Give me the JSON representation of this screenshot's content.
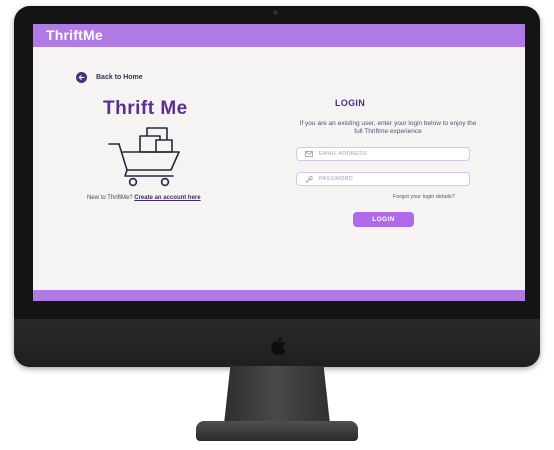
{
  "app": {
    "brand": "ThriftMe"
  },
  "colors": {
    "accent": "#b07ae4",
    "button": "#b069e8",
    "title": "#5b2e94",
    "screen_bg": "#f5f4f2",
    "monitor_bezel": "#141414"
  },
  "nav": {
    "back_label": "Back to Home",
    "back_icon": "arrow-left-icon"
  },
  "left_panel": {
    "title": "Thrift Me",
    "illustration_icon": "shopping-cart-icon",
    "signup_prompt": "New to ThriftMe?",
    "signup_link": "Create an account here"
  },
  "login": {
    "heading": "LOGIN",
    "description": "If you are an existing user, enter your login below to enjoy the full Thriftme experience",
    "email": {
      "placeholder": "EMAIL ADDRESS",
      "value": "",
      "icon": "envelope-icon"
    },
    "password": {
      "placeholder": "PASSWORD",
      "value": "",
      "icon": "key-icon"
    },
    "forgot_label": "Forgot your login details?",
    "submit_label": "LOGIN"
  },
  "device": {
    "logo_icon": "apple-logo-icon"
  }
}
